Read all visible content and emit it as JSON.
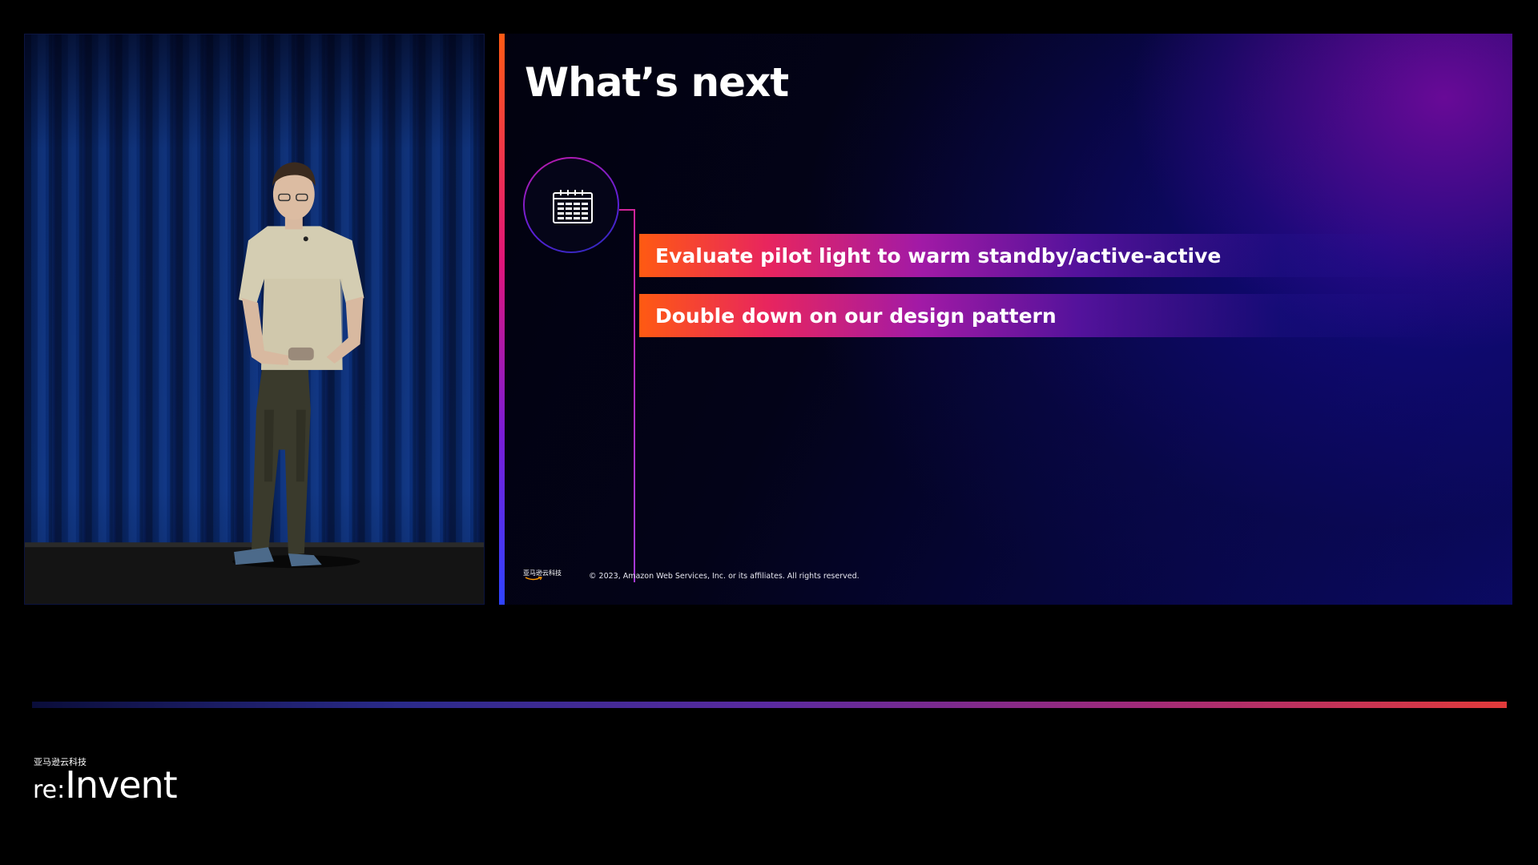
{
  "slide": {
    "title": "What’s next",
    "items": [
      {
        "text": "Evaluate pilot light to warm standby/active-active"
      },
      {
        "text": "Double down on our design pattern"
      }
    ],
    "footer_logo_text": "亚马逊云科技",
    "copyright": "© 2023, Amazon Web Services, Inc. or its affiliates. All rights reserved.",
    "icon": "calendar-icon"
  },
  "brand": {
    "chinese_name": "亚马逊云科技",
    "event_prefix": "re:",
    "event_name": "Invent"
  },
  "colors": {
    "accent_orange": "#ff5a12",
    "accent_magenta": "#d0249a",
    "accent_purple": "#7a1cd6",
    "accent_blue": "#2f43ff",
    "background": "#000000"
  }
}
